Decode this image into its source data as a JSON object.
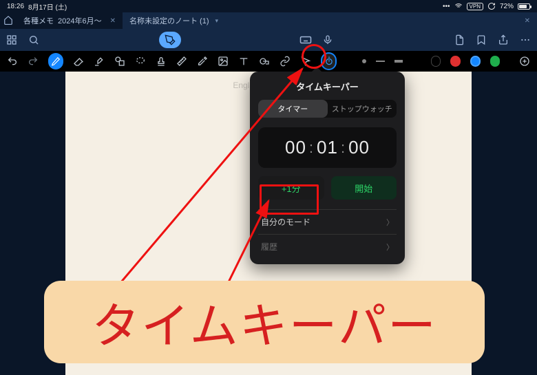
{
  "status": {
    "time": "18:26",
    "date": "8月17日 (土)",
    "vpn": "VPN",
    "battery_pct": "72%"
  },
  "tabs": {
    "left_title_a": "各種メモ",
    "left_title_b": "2024年6月〜",
    "right_title": "名称未設定のノート (1)"
  },
  "canvas": {
    "type_hint": "English (US)のライ"
  },
  "popover": {
    "title": "タイムキーパー",
    "seg_timer": "タイマー",
    "seg_stopwatch": "ストップウォッチ",
    "hh": "00",
    "mm": "01",
    "ss": "00",
    "plus1": "+1分",
    "start": "開始",
    "mode_row": "自分のモード",
    "history_row": "履歴"
  },
  "annotation": {
    "callout": "タイムキーパー"
  }
}
